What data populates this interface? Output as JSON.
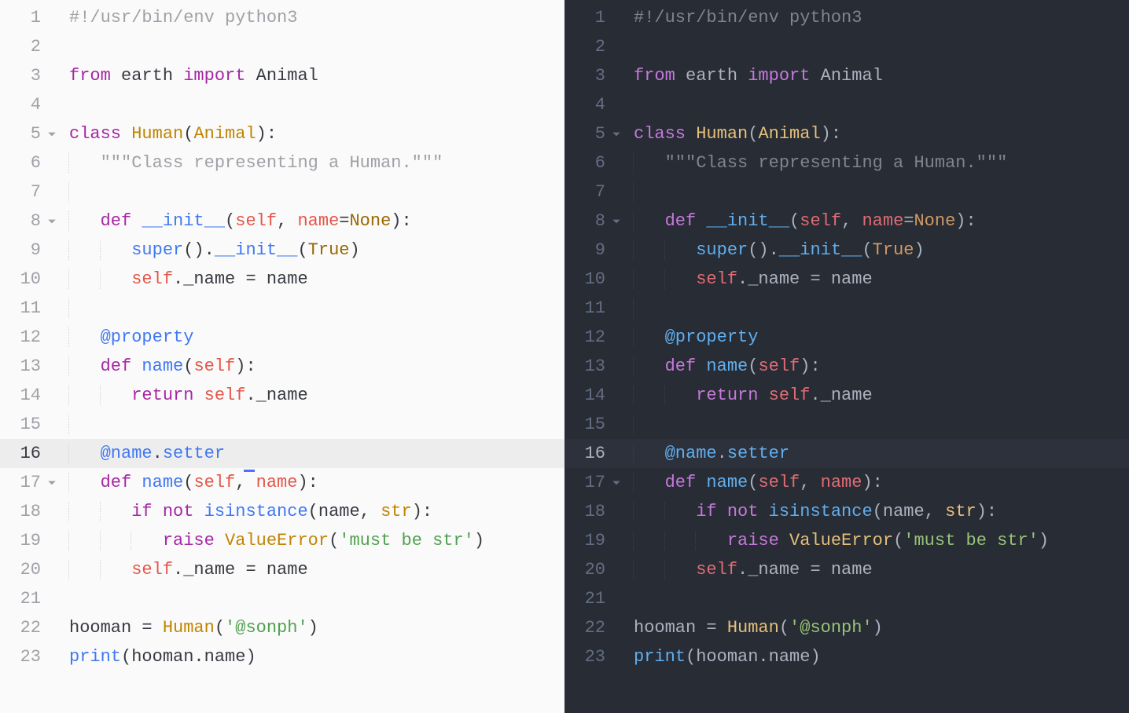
{
  "themes": {
    "light": {
      "name": "one-half-light",
      "bg": "#fafafa",
      "fg": "#383a42",
      "gutter": "#a0a1a7",
      "active_line": "#ededed",
      "keyword": "#a626a4",
      "class": "#c18401",
      "function": "#4078f2",
      "self": "#e45649",
      "constant": "#986801",
      "string": "#50a14f",
      "comment": "#a0a1a7"
    },
    "dark": {
      "name": "one-half-dark",
      "bg": "#282c34",
      "fg": "#abb2bf",
      "gutter": "#636d83",
      "active_line": "#2c313c",
      "keyword": "#c678dd",
      "class": "#e5c07b",
      "function": "#61afef",
      "self": "#e06c75",
      "constant": "#d19a66",
      "string": "#98c379",
      "comment": "#7f848e"
    }
  },
  "active_line": 16,
  "fold_lines": [
    5,
    8,
    17
  ],
  "lines": [
    {
      "n": 1,
      "i": 0,
      "t": [
        [
          "cm",
          "#!/usr/bin/env python3"
        ]
      ]
    },
    {
      "n": 2,
      "i": 0,
      "t": []
    },
    {
      "n": 3,
      "i": 0,
      "t": [
        [
          "kw",
          "from"
        ],
        [
          "p",
          " earth "
        ],
        [
          "kw",
          "import"
        ],
        [
          "p",
          " Animal"
        ]
      ]
    },
    {
      "n": 4,
      "i": 0,
      "t": []
    },
    {
      "n": 5,
      "i": 0,
      "t": [
        [
          "sd",
          "class"
        ],
        [
          "p",
          " "
        ],
        [
          "cls",
          "Human"
        ],
        [
          "p",
          "("
        ],
        [
          "clsu",
          "Animal"
        ],
        [
          "p",
          "):"
        ]
      ]
    },
    {
      "n": 6,
      "i": 1,
      "t": [
        [
          "cm",
          "\"\"\"Class representing a Human.\"\"\""
        ]
      ]
    },
    {
      "n": 7,
      "i": 1,
      "t": []
    },
    {
      "n": 8,
      "i": 1,
      "t": [
        [
          "sd",
          "def"
        ],
        [
          "p",
          " "
        ],
        [
          "fn",
          "__init__"
        ],
        [
          "p",
          "("
        ],
        [
          "slf",
          "self"
        ],
        [
          "p",
          ", "
        ],
        [
          "prm",
          "name"
        ],
        [
          "p",
          "="
        ],
        [
          "cst",
          "None"
        ],
        [
          "p",
          "):"
        ]
      ]
    },
    {
      "n": 9,
      "i": 2,
      "t": [
        [
          "fn",
          "super"
        ],
        [
          "p",
          "()."
        ],
        [
          "fn",
          "__init__"
        ],
        [
          "p",
          "("
        ],
        [
          "cst",
          "True"
        ],
        [
          "p",
          ")"
        ]
      ]
    },
    {
      "n": 10,
      "i": 2,
      "t": [
        [
          "slf",
          "self"
        ],
        [
          "p",
          "._name = name"
        ]
      ]
    },
    {
      "n": 11,
      "i": 1,
      "t": []
    },
    {
      "n": 12,
      "i": 1,
      "t": [
        [
          "fn",
          "@property"
        ]
      ]
    },
    {
      "n": 13,
      "i": 1,
      "t": [
        [
          "sd",
          "def"
        ],
        [
          "p",
          " "
        ],
        [
          "fn",
          "name"
        ],
        [
          "p",
          "("
        ],
        [
          "slf",
          "self"
        ],
        [
          "p",
          "):"
        ]
      ]
    },
    {
      "n": 14,
      "i": 2,
      "t": [
        [
          "kw",
          "return"
        ],
        [
          "p",
          " "
        ],
        [
          "slf",
          "self"
        ],
        [
          "p",
          "._name"
        ]
      ]
    },
    {
      "n": 15,
      "i": 1,
      "t": []
    },
    {
      "n": 16,
      "i": 1,
      "cursor": true,
      "t": [
        [
          "fn",
          "@name"
        ],
        [
          "p",
          "."
        ],
        [
          "fn",
          "setter"
        ]
      ]
    },
    {
      "n": 17,
      "i": 1,
      "t": [
        [
          "sd",
          "def"
        ],
        [
          "p",
          " "
        ],
        [
          "fn",
          "name"
        ],
        [
          "p",
          "("
        ],
        [
          "slf",
          "self"
        ],
        [
          "p",
          ", "
        ],
        [
          "prm",
          "name"
        ],
        [
          "p",
          "):"
        ]
      ]
    },
    {
      "n": 18,
      "i": 2,
      "t": [
        [
          "kw",
          "if"
        ],
        [
          "p",
          " "
        ],
        [
          "kw",
          "not"
        ],
        [
          "p",
          " "
        ],
        [
          "fn",
          "isinstance"
        ],
        [
          "p",
          "(name, "
        ],
        [
          "cls",
          "str"
        ],
        [
          "p",
          "):"
        ]
      ]
    },
    {
      "n": 19,
      "i": 3,
      "t": [
        [
          "kw",
          "raise"
        ],
        [
          "p",
          " "
        ],
        [
          "cls",
          "ValueError"
        ],
        [
          "p",
          "("
        ],
        [
          "str",
          "'must be str'"
        ],
        [
          "p",
          ")"
        ]
      ]
    },
    {
      "n": 20,
      "i": 2,
      "t": [
        [
          "slf",
          "self"
        ],
        [
          "p",
          "._name = name"
        ]
      ]
    },
    {
      "n": 21,
      "i": 0,
      "t": []
    },
    {
      "n": 22,
      "i": 0,
      "t": [
        [
          "p",
          "hooman = "
        ],
        [
          "cls",
          "Human"
        ],
        [
          "p",
          "("
        ],
        [
          "str",
          "'@sonph'"
        ],
        [
          "p",
          ")"
        ]
      ]
    },
    {
      "n": 23,
      "i": 0,
      "t": [
        [
          "fn",
          "print"
        ],
        [
          "p",
          "(hooman.name)"
        ]
      ]
    }
  ]
}
